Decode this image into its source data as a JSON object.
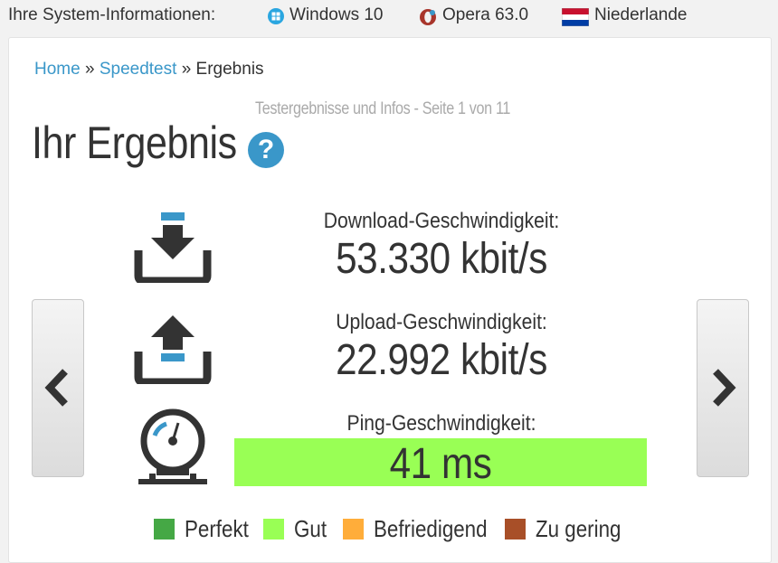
{
  "sysbar": {
    "label": "Ihre System-Informationen:",
    "os": "Windows 10",
    "browser": "Opera 63.0",
    "country": "Niederlande"
  },
  "breadcrumb": {
    "home": "Home",
    "sep1": "»",
    "speedtest": "Speedtest",
    "sep2": "»",
    "current": "Ergebnis"
  },
  "subtitle": "Testergebnisse und Infos - Seite 1 von 11",
  "title": "Ihr Ergebnis",
  "help_glyph": "?",
  "download": {
    "label": "Download-Geschwindigkeit:",
    "value": "53.330 kbit/s"
  },
  "upload": {
    "label": "Upload-Geschwindigkeit:",
    "value": "22.992 kbit/s"
  },
  "ping": {
    "label": "Ping-Geschwindigkeit:",
    "value": "41 ms",
    "rating_color": "#99ff55"
  },
  "legend": [
    {
      "label": "Perfekt",
      "color": "#45a845"
    },
    {
      "label": "Gut",
      "color": "#99ff55"
    },
    {
      "label": "Befriedigend",
      "color": "#ffad3a"
    },
    {
      "label": "Zu gering",
      "color": "#a84f28"
    }
  ],
  "colors": {
    "accent": "#3a97c9",
    "text": "#333333"
  },
  "icons": {
    "os": "windows-icon",
    "browser": "opera-icon",
    "country": "netherlands-flag-icon",
    "download": "download-icon",
    "upload": "upload-icon",
    "ping": "gauge-icon",
    "prev": "chevron-left-icon",
    "next": "chevron-right-icon"
  }
}
